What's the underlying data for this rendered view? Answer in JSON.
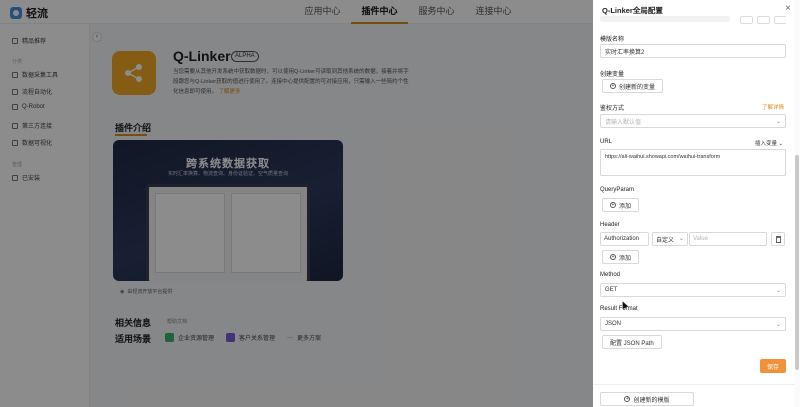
{
  "app": {
    "logo_text": "轻流",
    "nav": [
      "应用中心",
      "插件中心",
      "服务中心",
      "连接中心"
    ],
    "nav_active_index": 1,
    "accent_color": "#d88a1c"
  },
  "sidebar": {
    "items": [
      {
        "label": "精品推荐",
        "icon": "grid-icon"
      },
      {
        "label": "数据采集工具",
        "icon": "database-icon"
      },
      {
        "label": "流程自动化",
        "icon": "flow-icon"
      },
      {
        "label": "Q-Robot",
        "icon": "robot-icon"
      },
      {
        "label": "第三方连接",
        "icon": "link-icon"
      },
      {
        "label": "数据可视化",
        "icon": "chart-icon"
      },
      {
        "label": "已安装",
        "icon": "installed-icon"
      }
    ]
  },
  "plugin": {
    "name": "Q-Linker",
    "badge": "ALPHA",
    "description": "当您需要从其他开发系统中获取数据时，可以使用Q-Linker可读取到其他系统的数据，接着并将字段跟您与Q-Linker获取的值进行使用了。连接中心提供配置的可对接应用，只需输入一些简约个性化信息即可使用。",
    "more_link": "了解更多",
    "section_intro": "插件介绍",
    "banner_title": "跨系统数据获取",
    "banner_subtitle": "实时汇率换算、物流查询、身份证验证、空气质量查询",
    "banner_caption": "由轻流开放平台提供",
    "related_title": "相关信息",
    "help_link": "帮助文档",
    "scenes_title": "适用场景",
    "scenes": [
      {
        "label": "企业资源管理",
        "color": "#3fb26b"
      },
      {
        "label": "客户关系管理",
        "color": "#7a5cd6"
      },
      {
        "label": "更多方案",
        "color": "#999999"
      }
    ]
  },
  "drawer": {
    "title": "Q-Linker全局配置",
    "template_name_label": "模版名称",
    "template_name_value": "实时汇率换算2",
    "create_var_label": "创建变量",
    "create_var_button": "创建新的变量",
    "auth_label": "鉴权方式",
    "auth_learn_more": "了解详情",
    "auth_placeholder": "请输入默认值",
    "url_label": "URL",
    "url_insert_var": "插入变量",
    "url_value": "https://ali-waihui.showapi.com/waihui-transform",
    "queryparam_label": "QueryParam",
    "add_label": "添加",
    "header_label": "Header",
    "header_key": "Authorization",
    "header_type": "自定义",
    "header_value_placeholder": "Value",
    "method_label": "Method",
    "method_value": "GET",
    "result_format_label": "Result Format",
    "result_format_value": "JSON",
    "config_json_path": "配置 JSON Path",
    "save_button": "保存",
    "create_template_button": "创建新的模版",
    "primary_color": "#f0923a"
  }
}
